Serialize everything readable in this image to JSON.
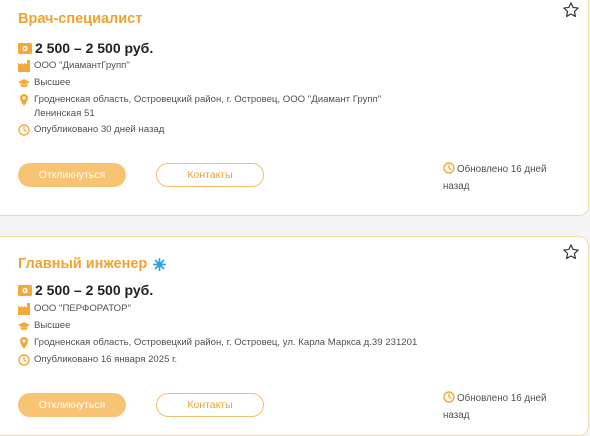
{
  "vacancies": [
    {
      "title": "Врач-специалист",
      "salary": "2 500 – 2 500 руб.",
      "company": "ООО \"ДиамантГрупп\"",
      "education": "Высшее",
      "address": "Гродненская область, Островецкий район, г. Островец, ООО \"Диамант Групп\" Ленинская 51",
      "published": "Опубликовано 30 дней назад",
      "apply_label": "Откликнуться",
      "contacts_label": "Контакты",
      "updated": "Обновлено 16 дней назад"
    },
    {
      "title": "Главный инженер",
      "salary": "2 500 – 2 500 руб.",
      "company": "ООО \"ПЕРФОРАТОР\"",
      "education": "Высшее",
      "address": "Гродненская область, Островецкий район, г. Островец, ул. Карла Маркса д.39 231201",
      "published": "Опубликовано 16 января 2025 г.",
      "apply_label": "Откликнуться",
      "contacts_label": "Контакты",
      "updated": "Обновлено 16 дней назад"
    }
  ],
  "colors": {
    "accent": "#f0a330",
    "button": "#f8c474",
    "border": "#f6d9a0",
    "icon": "#f3a93a",
    "sparkle": "#29a3dd"
  },
  "icons": [
    "star-outline-icon",
    "money-icon",
    "factory-icon",
    "graduation-cap-icon",
    "location-pin-icon",
    "clock-icon",
    "sparkle-icon"
  ]
}
